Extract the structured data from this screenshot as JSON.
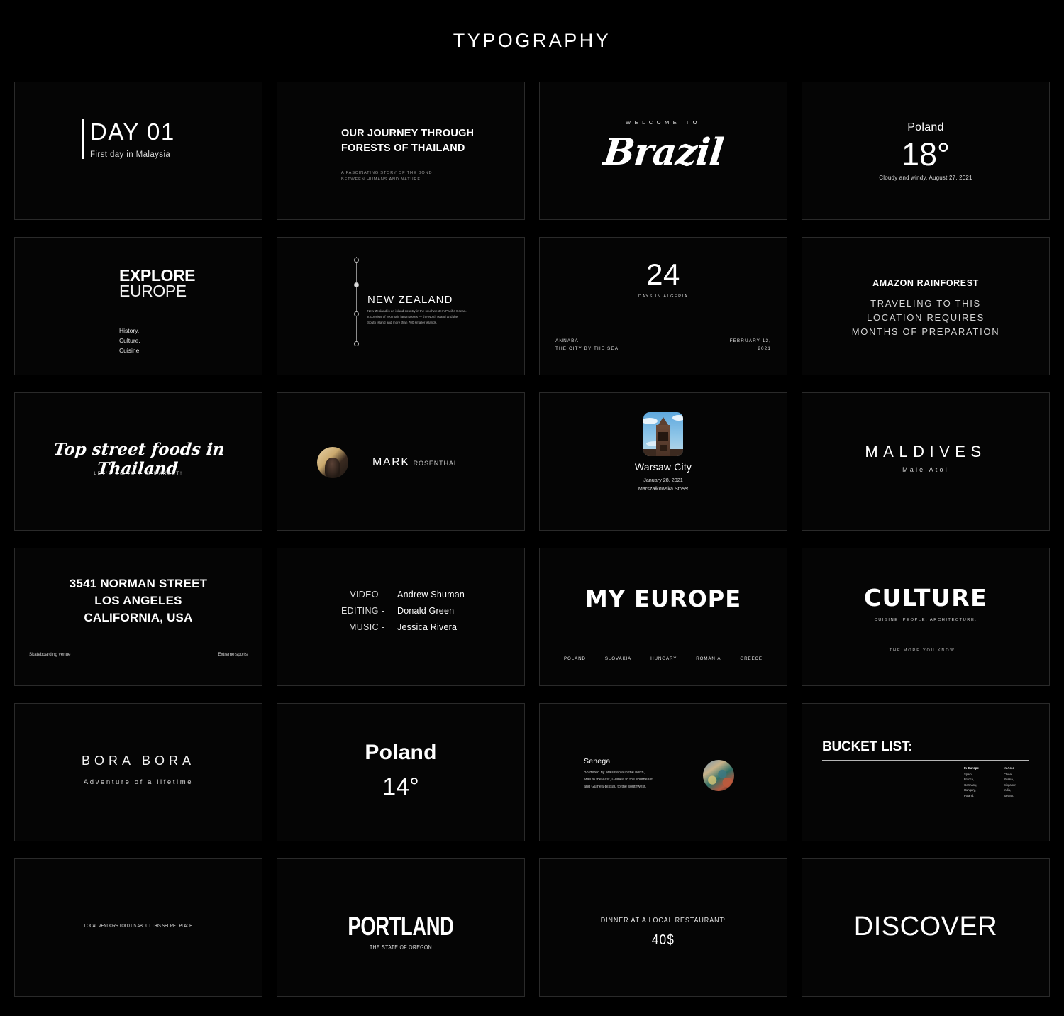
{
  "header": {
    "title": "TYPOGRAPHY"
  },
  "cards": {
    "day01": {
      "title": "DAY 01",
      "subtitle": "First day in Malaysia"
    },
    "journey": {
      "title": "OUR JOURNEY THROUGH\nFORESTS OF THAILAND",
      "title_line1": "OUR JOURNEY THROUGH",
      "title_line2": "FORESTS OF THAILAND",
      "sub_line1": "A FASCINATING STORY OF THE BOND",
      "sub_line2": "BETWEEN HUMANS AND NATURE"
    },
    "brazil": {
      "kicker": "WELCOME TO",
      "title": "Brazil"
    },
    "poland18": {
      "country": "Poland",
      "temperature": "18°",
      "note": "Cloudy and windy. August 27, 2021"
    },
    "explore": {
      "line1": "EXPLORE",
      "line2": "EUROPE",
      "list1": "History,",
      "list2": "Culture,",
      "list3": "Cuisine."
    },
    "newzealand": {
      "title": "NEW ZEALAND",
      "body": "New Zealand is an island country in the southwestern Pacific Ocean. It consists of two main landmasses — the North Island and the South Island and more than 700 smaller islands."
    },
    "algeria": {
      "number": "24",
      "label": "DAYS IN ALGERIA",
      "city_line1": "ANNABA",
      "city_line2": "THE CITY BY THE SEA",
      "date_line1": "FEBRUARY 12,",
      "date_line2": "2021"
    },
    "amazon": {
      "title": "AMAZON RAINFOREST",
      "body_line1": "TRAVELING TO THIS",
      "body_line2": "LOCATION REQUIRES",
      "body_line3": "MONTHS OF PREPARATION"
    },
    "thaifood": {
      "title": "Top street foods in Thailand",
      "subtitle": "LET'S GO TO THE MARKET!"
    },
    "mark": {
      "first_name": "MARK",
      "last_name": "ROSENTHAL"
    },
    "warsaw": {
      "title": "Warsaw City",
      "date": "January 28, 2021",
      "street": "Marszałkowska Street"
    },
    "maldives": {
      "title": "MALDIVES",
      "subtitle": "Male Atol"
    },
    "address": {
      "line1": "3541 NORMAN STREET",
      "line2": "LOS ANGELES",
      "line3": "CALIFORNIA, USA",
      "tag_left": "Skateboarding venue",
      "tag_right": "Extreme sports"
    },
    "credits": {
      "rows": [
        {
          "role": "VIDEO -",
          "name": "Andrew Shuman"
        },
        {
          "role": "EDITING -",
          "name": "Donald Green"
        },
        {
          "role": "MUSIC -",
          "name": "Jessica Rivera"
        }
      ]
    },
    "myeurope": {
      "title": "MY EUROPE",
      "countries": [
        "POLAND",
        "SLOVAKIA",
        "HUNGARY",
        "ROMANIA",
        "GREECE"
      ]
    },
    "culture": {
      "title": "CULTURE",
      "subtitle": "CUISINE. PEOPLE. ARCHITECTURE.",
      "footer": "THE MORE YOU KNOW..."
    },
    "borabora": {
      "title": "BORA BORA",
      "subtitle": "Adventure of a lifetime"
    },
    "poland14": {
      "country": "Poland",
      "temperature": "14°"
    },
    "senegal": {
      "title": "Senegal",
      "body_line1": "Bordered by Mauritania in the north,",
      "body_line2": "Mali to the east, Guinea to the southeast,",
      "body_line3": "and Guinea-Bissau to the southwest."
    },
    "bucketlist": {
      "title": "BUCKET LIST:",
      "col1_header": "In Europe",
      "col1_items": "Spain,\nFrance,\nGermany,\nHungary,\nPoland.",
      "col2_header": "In Asia",
      "col2_items": "China,\nRussia,\nSingapur,\nIndia,\nTaiwan."
    },
    "vendors": {
      "text": "LOCAL VENDORS TOLD US ABOUT THIS SECRET PLACE"
    },
    "portland": {
      "title": "PORTLAND",
      "subtitle": "THE STATE OF OREGON"
    },
    "dinner": {
      "label": "DINNER AT A LOCAL RESTAURANT:",
      "price": "40$"
    },
    "discover": {
      "title": "DISCOVER"
    }
  },
  "colors": {
    "background": "#000000",
    "text": "#ffffff",
    "muted": "#c9c9c9",
    "card_border": "#2a2a2a"
  }
}
